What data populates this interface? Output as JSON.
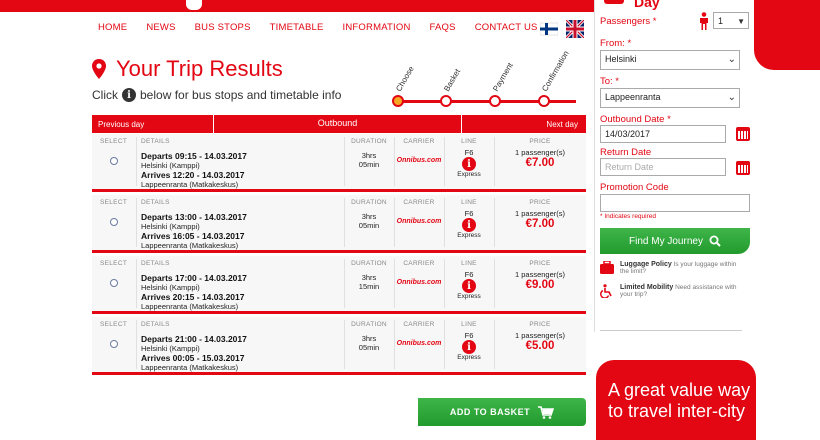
{
  "nav": [
    "HOME",
    "NEWS",
    "BUS STOPS",
    "TIMETABLE",
    "INFORMATION",
    "FAQS",
    "CONTACT US"
  ],
  "page": {
    "title": "Your Trip Results",
    "subtitle_pre": "Click",
    "subtitle_post": "below for bus stops and timetable info"
  },
  "progress": {
    "steps": [
      "Choose",
      "Basket",
      "Payment",
      "Confirmation"
    ],
    "active_step": "Choose"
  },
  "results_header": {
    "prev": "Previous day",
    "title": "Outbound",
    "next": "Next day"
  },
  "column_headers": {
    "select": "SELECT",
    "details": "DETAILS",
    "duration": "DURATION",
    "carrier": "CARRIER",
    "line": "LINE",
    "price": "PRICE"
  },
  "trips": [
    {
      "departs": "Departs 09:15 - 14.03.2017",
      "from": "Helsinki (Kamppi)",
      "arrives": "Arrives 12:20 - 14.03.2017",
      "to": "Lappeenranta (Matkakeskus)",
      "dur_h": "3hrs",
      "dur_m": "05min",
      "carrier": "Onnibus.com",
      "line": "F6",
      "line_type": "Express",
      "passengers": "1 passenger(s)",
      "price": "€7.00"
    },
    {
      "departs": "Departs 13:00 - 14.03.2017",
      "from": "Helsinki (Kamppi)",
      "arrives": "Arrives 16:05 - 14.03.2017",
      "to": "Lappeenranta (Matkakeskus)",
      "dur_h": "3hrs",
      "dur_m": "05min",
      "carrier": "Onnibus.com",
      "line": "F6",
      "line_type": "Express",
      "passengers": "1 passenger(s)",
      "price": "€7.00"
    },
    {
      "departs": "Departs 17:00 - 14.03.2017",
      "from": "Helsinki (Kamppi)",
      "arrives": "Arrives 20:15 - 14.03.2017",
      "to": "Lappeenranta (Matkakeskus)",
      "dur_h": "3hrs",
      "dur_m": "15min",
      "carrier": "Onnibus.com",
      "line": "F6",
      "line_type": "Express",
      "passengers": "1 passenger(s)",
      "price": "€9.00"
    },
    {
      "departs": "Departs 21:00 - 14.03.2017",
      "from": "Helsinki (Kamppi)",
      "arrives": "Arrives 00:05 - 15.03.2017",
      "to": "Lappeenranta (Matkakeskus)",
      "dur_h": "3hrs",
      "dur_m": "05min",
      "carrier": "Onnibus.com",
      "line": "F6",
      "line_type": "Express",
      "passengers": "1 passenger(s)",
      "price": "€5.00"
    }
  ],
  "add_basket": "ADD TO BASKET",
  "sidebar": {
    "heading": "Day",
    "passengers_label": "Passengers *",
    "passengers_value": "1",
    "from_label": "From: *",
    "from_value": "Helsinki",
    "to_label": "To: *",
    "to_value": "Lappeenranta",
    "outbound_label": "Outbound Date *",
    "outbound_value": "14/03/2017",
    "return_label": "Return Date",
    "return_placeholder": "Return Date",
    "promo_label": "Promotion Code",
    "required_note": "* Indicates required",
    "find_button": "Find My Journey",
    "luggage_title": "Luggage Policy",
    "luggage_text": "Is your luggage within the limit?",
    "mobility_title": "Limited Mobility",
    "mobility_text": "Need assistance with your trip?"
  },
  "promo_text": "A great value way to travel inter-city",
  "colors": {
    "brand_red": "#e30613",
    "green": "#2fa83a"
  }
}
